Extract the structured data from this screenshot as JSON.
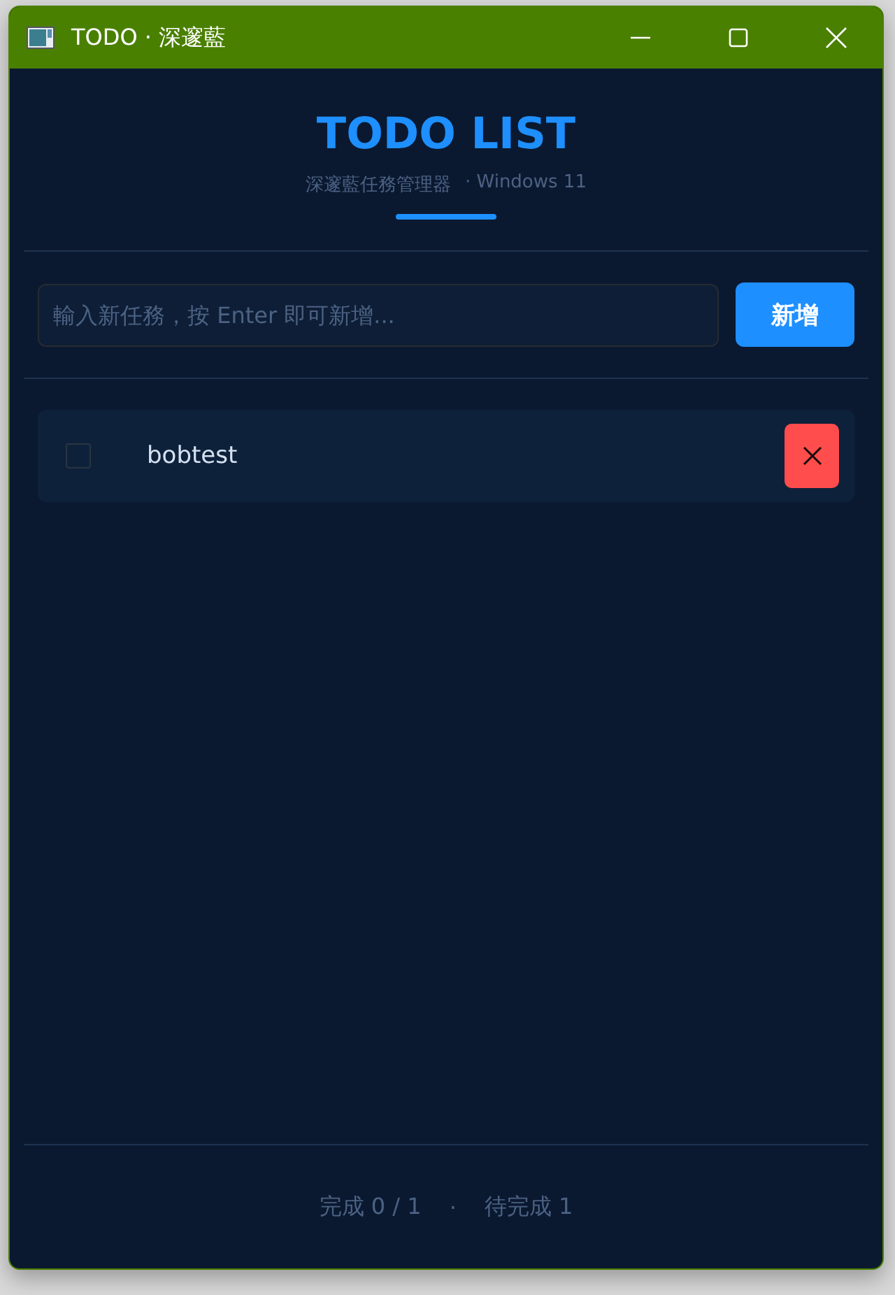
{
  "window": {
    "title": "TODO · 深邃藍"
  },
  "header": {
    "title": "TODO LIST",
    "subtitle": "深邃藍任務管理器",
    "platform": "· Windows 11"
  },
  "new_task": {
    "placeholder": "輸入新任務，按 Enter 即可新增...",
    "button": "新增"
  },
  "todos": [
    {
      "text": "bobtest",
      "checked": false
    }
  ],
  "footer": {
    "done": "完成 0 / 1",
    "separator": "·",
    "pending": "待完成 1"
  }
}
